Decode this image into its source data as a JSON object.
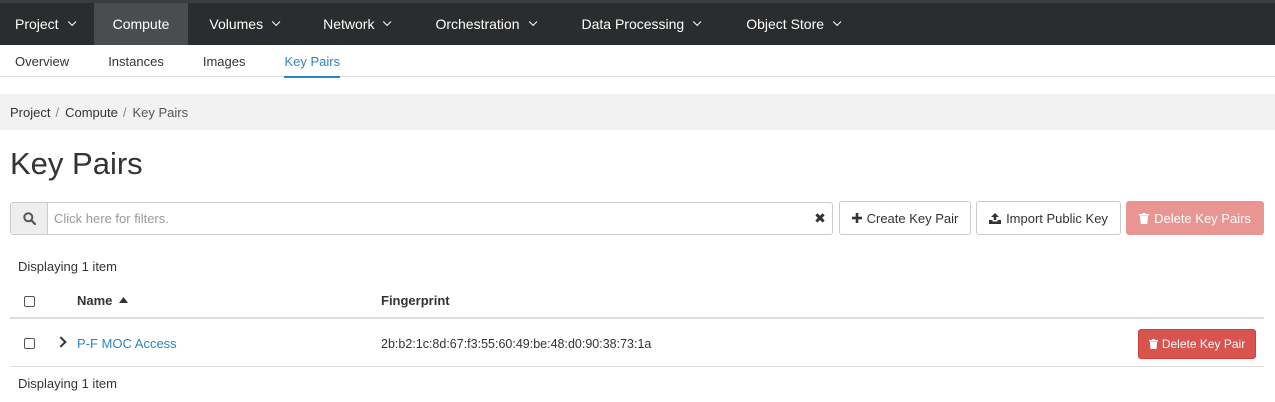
{
  "topnav": {
    "items": [
      {
        "label": "Project",
        "active": false
      },
      {
        "label": "Compute",
        "active": true
      },
      {
        "label": "Volumes",
        "active": false
      },
      {
        "label": "Network",
        "active": false
      },
      {
        "label": "Orchestration",
        "active": false
      },
      {
        "label": "Data Processing",
        "active": false
      },
      {
        "label": "Object Store",
        "active": false
      }
    ]
  },
  "subnav": {
    "items": [
      {
        "label": "Overview",
        "active": false
      },
      {
        "label": "Instances",
        "active": false
      },
      {
        "label": "Images",
        "active": false
      },
      {
        "label": "Key Pairs",
        "active": true
      }
    ]
  },
  "breadcrumb": [
    "Project",
    "Compute",
    "Key Pairs"
  ],
  "page_title": "Key Pairs",
  "filter": {
    "placeholder": "Click here for filters.",
    "value": ""
  },
  "actions": {
    "create": "Create Key Pair",
    "import": "Import Public Key",
    "delete": "Delete Key Pairs"
  },
  "count_top": "Displaying 1 item",
  "count_bottom": "Displaying 1 item",
  "table": {
    "columns": [
      "Name",
      "Fingerprint"
    ],
    "rows": [
      {
        "name": "P-F MOC Access",
        "fingerprint": "2b:b2:1c:8d:67:f3:55:60:49:be:48:d0:90:38:73:1a",
        "action": "Delete Key Pair"
      }
    ]
  },
  "colors": {
    "accent": "#2d85c4",
    "danger": "#d9534f",
    "danger_disabled": "#e99592",
    "topnav_bg": "#2a2c2e"
  }
}
